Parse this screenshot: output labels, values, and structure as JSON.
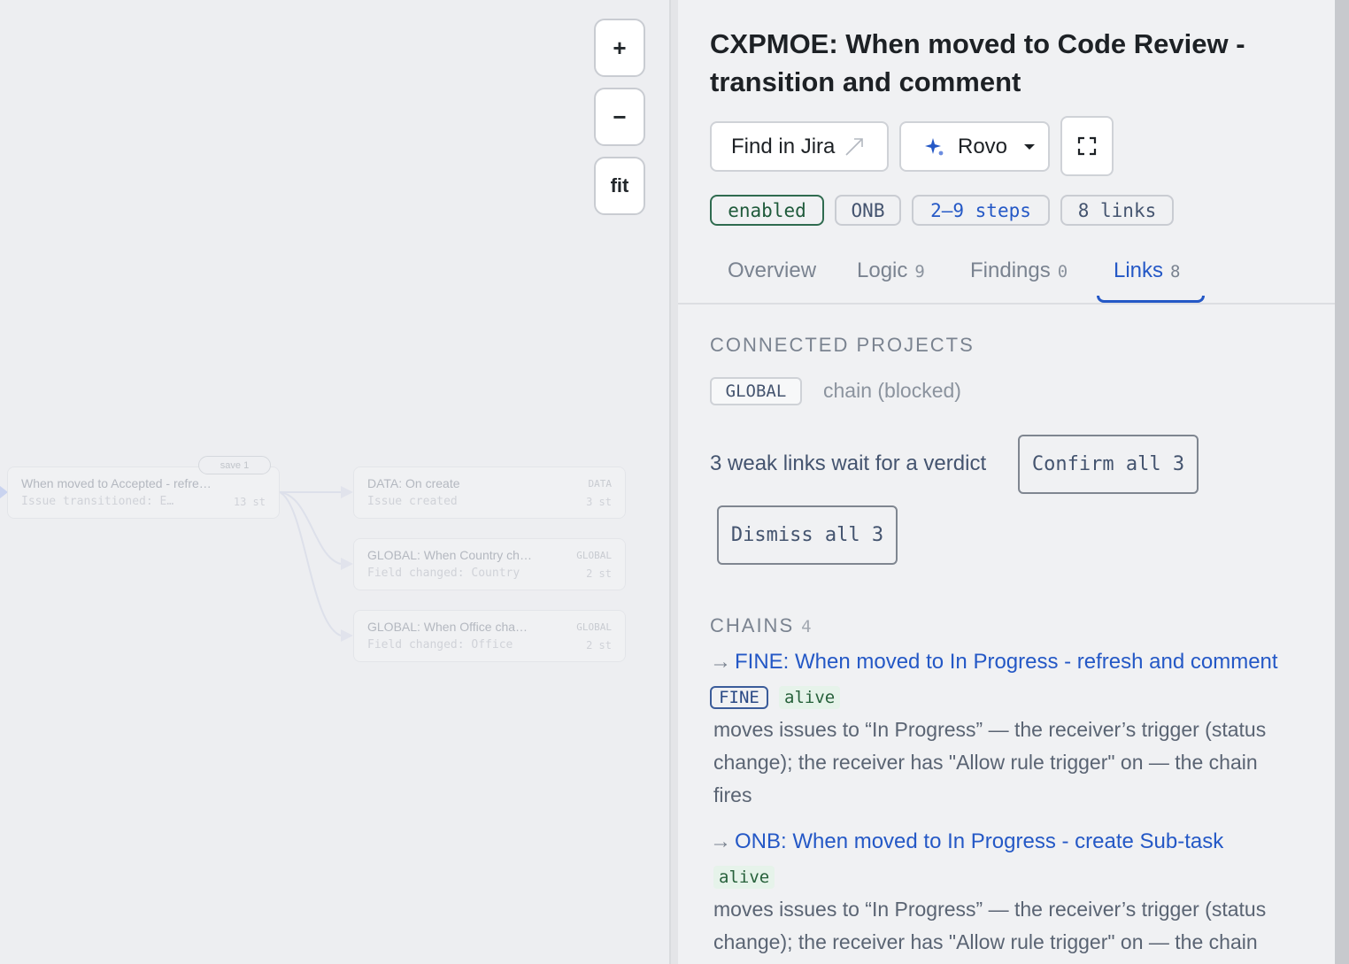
{
  "canvas": {
    "zoom_in_label": "+",
    "zoom_out_label": "−",
    "fit_label": "fit",
    "source_node": {
      "title": "When moved to Accepted - refre…",
      "subtitle": "Issue transitioned: E…",
      "steps": "13 st",
      "save_label": "save 1"
    },
    "target_nodes": [
      {
        "title": "DATA: On create",
        "subtitle": "Issue created",
        "tag": "DATA",
        "steps": "3 st"
      },
      {
        "title": "GLOBAL: When Country ch…",
        "subtitle": "Field changed: Country",
        "tag": "GLOBAL",
        "steps": "2 st"
      },
      {
        "title": "GLOBAL: When Office cha…",
        "subtitle": "Field changed: Office",
        "tag": "GLOBAL",
        "steps": "2 st"
      }
    ]
  },
  "panel": {
    "title": "CXPMOE: When moved to Code Review - transition and comment",
    "buttons": {
      "find_in_jira": "Find in Jira",
      "find_icon": "external-link-icon",
      "rovo": "Rovo",
      "rovo_icon": "sparkle-icon",
      "rovo_caret_icon": "caret-down-icon",
      "expand_icon": "expand-icon"
    },
    "badges": {
      "status": "enabled",
      "project": "ONB",
      "steps": "2–9 steps",
      "links": "8 links"
    },
    "tabs": [
      {
        "label": "Overview",
        "count": ""
      },
      {
        "label": "Logic",
        "count": "9"
      },
      {
        "label": "Findings",
        "count": "0"
      },
      {
        "label": "Links",
        "count": "8"
      }
    ],
    "active_tab": "Links",
    "connected_projects": {
      "heading": "CONNECTED PROJECTS",
      "project": "GLOBAL",
      "note": "chain (blocked)"
    },
    "verdict": {
      "text": "3 weak links wait for a verdict",
      "confirm_label": "Confirm all 3",
      "dismiss_label": "Dismiss all 3"
    },
    "chains": {
      "heading": "CHAINS",
      "count": "4",
      "arrow": "→",
      "items": [
        {
          "title": "FINE: When moved to In Progress - refresh and comment",
          "project": "FINE",
          "status": "alive",
          "description": "moves issues to “In Progress” — the receiver’s trigger (status change); the receiver has \"Allow rule trigger\" on — the chain fires"
        },
        {
          "title": "ONB: When moved to In Progress - create Sub-task",
          "project": "",
          "status": "alive",
          "description": "moves issues to “In Progress” — the receiver’s trigger (status change); the receiver has \"Allow rule trigger\" on — the chain"
        }
      ]
    }
  },
  "colors": {
    "accent": "#2458c6",
    "enabled_border": "#2f6b4f",
    "alive_bg": "#e6f3ea",
    "panel_bg": "#f0f1f3",
    "canvas_bg": "#edeef1"
  }
}
